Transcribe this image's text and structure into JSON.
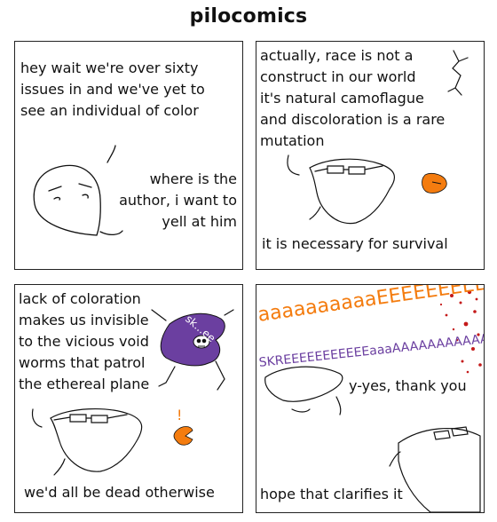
{
  "title": "pilocomics",
  "panels": [
    {
      "caption": "hey wait we're over sixty\nissues in and we've yet to\nsee an individual of color",
      "speech": "where is the\nauthor, i want to\nyell at him"
    },
    {
      "caption": "actually, race is not a\nconstruct in our world\nit's natural camoflague\nand discoloration is a rare\nmutation",
      "speech": "it is necessary for survival"
    },
    {
      "caption": "lack of coloration\nmakes us invisible\nto the vicious void\nworms that patrol\nthe ethereal plane",
      "worm_label": "sk...ee",
      "exclaim": "!",
      "speech": "we'd all be dead otherwise"
    },
    {
      "scream_orange": "aaaaaaaaaaEEEEEEEEEEEEE",
      "scream_purple": "SKREEEEEEEEEEEaaaAAAAAAAAAAA",
      "speech1": "y-yes, thank you",
      "speech2": "hope that clarifies it"
    }
  ],
  "colors": {
    "orange": "#f47c0f",
    "purple": "#6b3fa0",
    "blood": "#c41a1a"
  }
}
